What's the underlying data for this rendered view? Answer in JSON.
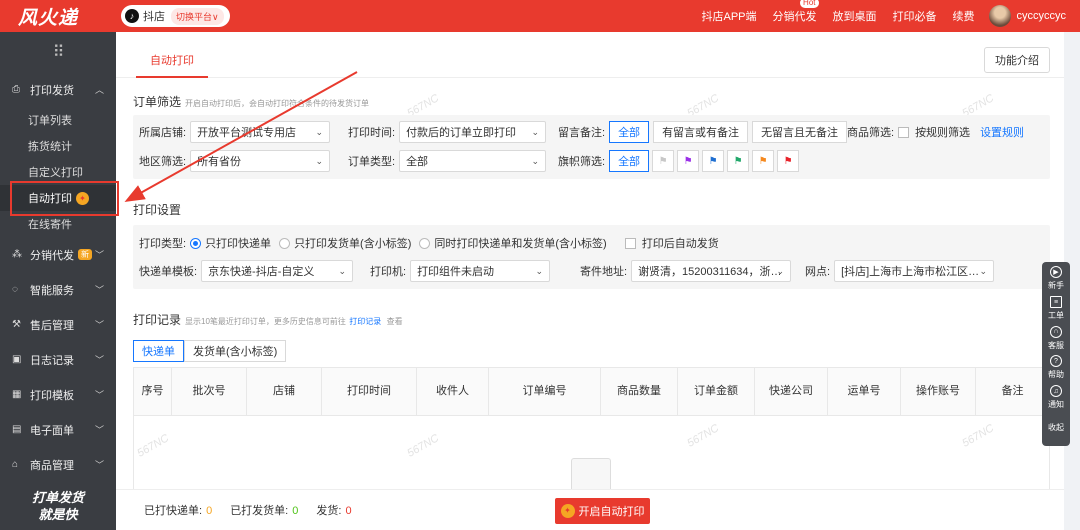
{
  "topbar": {
    "logo": "风火递",
    "platform_icon": "tiktok-icon",
    "platform_name": "抖店",
    "switch_label": "切换平台∨",
    "nav": [
      "抖店APP端",
      "分销代发",
      "放到桌面",
      "打印必备",
      "续费"
    ],
    "hot_badge": "Hot",
    "username": "cyccyccyc"
  },
  "sidebar": {
    "groups": [
      {
        "label": "打印发货",
        "icon": "printer-icon",
        "expanded": true,
        "items": [
          "订单列表",
          "拣货统计",
          "自定义打印",
          "自动打印",
          "在线寄件"
        ]
      },
      {
        "label": "分销代发",
        "icon": "share-icon",
        "badge": "新"
      },
      {
        "label": "智能服务",
        "icon": "bulb-icon"
      },
      {
        "label": "售后管理",
        "icon": "wrench-icon"
      },
      {
        "label": "日志记录",
        "icon": "log-icon"
      },
      {
        "label": "打印模板",
        "icon": "template-icon"
      },
      {
        "label": "电子面单",
        "icon": "waybill-icon"
      },
      {
        "label": "商品管理",
        "icon": "goods-icon"
      }
    ],
    "active_item": "自动打印",
    "slogan_line1": "打单发货",
    "slogan_line2": "就是快"
  },
  "main": {
    "tab": "自动打印",
    "func_button": "功能介绍",
    "order_filter": {
      "title": "订单筛选",
      "hint": "开启自动打印后，会自动打印符合条件的待发货订单",
      "shop_label": "所属店铺:",
      "shop_value": "开放平台测试专用店",
      "print_time_label": "打印时间:",
      "print_time_value": "付款后的订单立即打印",
      "remark_label": "留言备注:",
      "remark_options": [
        "全部",
        "有留言或有备注",
        "无留言且无备注"
      ],
      "goods_label": "商品筛选:",
      "goods_checkbox": "按规则筛选",
      "goods_link": "设置规则",
      "region_label": "地区筛选:",
      "region_value": "所有省份",
      "order_type_label": "订单类型:",
      "order_type_value": "全部",
      "flag_label": "旗帜筛选:",
      "flag_all": "全部",
      "flag_colors": [
        "#c8c8c8",
        "#9b30e8",
        "#1f6fd1",
        "#22a86b",
        "#f5891f",
        "#e8222a"
      ]
    },
    "print_settings": {
      "title": "打印设置",
      "type_label": "打印类型:",
      "type_options": [
        "只打印快递单",
        "只打印发货单(含小标签)",
        "同时打印快递单和发货单(含小标签)"
      ],
      "auto_ship": "打印后自动发货",
      "template_label": "快递单模板:",
      "template_value": "京东快递-抖店-自定义",
      "printer_label": "打印机:",
      "printer_value": "打印组件未启动",
      "sender_label": "寄件地址:",
      "sender_value": "谢贤清，15200311634，浙…",
      "outlet_label": "网点:",
      "outlet_value": "[抖店]上海市上海市松江区…"
    },
    "records": {
      "title": "打印记录",
      "hint": "显示10笔最近打印订单，更多历史信息可前往",
      "link": "打印记录",
      "hint_after": "查看",
      "tabs": [
        "快递单",
        "发货单(含小标签)"
      ],
      "columns": [
        "序号",
        "批次号",
        "店铺",
        "打印时间",
        "收件人",
        "订单编号",
        "商品数量",
        "订单金额",
        "快递公司",
        "运单号",
        "操作账号",
        "备注"
      ]
    },
    "watermark": "567NC"
  },
  "footer": {
    "printed_express_label": "已打快递单:",
    "printed_express": "0",
    "printed_ship_label": "已打发货单:",
    "printed_ship": "0",
    "shipped_label": "发货:",
    "shipped": "0",
    "start_button": "开启自动打印"
  },
  "floatbar": [
    "新手",
    "工单",
    "客服",
    "帮助",
    "通知",
    "收起"
  ]
}
